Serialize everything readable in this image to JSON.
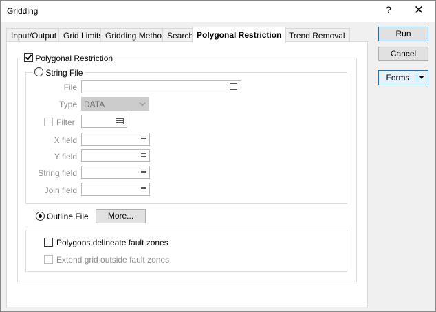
{
  "window": {
    "title": "Gridding",
    "help_label": "?",
    "close_label": "✕"
  },
  "tabs": [
    {
      "label": "Input/Output"
    },
    {
      "label": "Grid Limits"
    },
    {
      "label": "Gridding Method"
    },
    {
      "label": "Search"
    },
    {
      "label": "Polygonal Restriction",
      "active": true
    },
    {
      "label": "Trend Removal"
    }
  ],
  "buttons": {
    "run": "Run",
    "cancel": "Cancel",
    "forms": "Forms"
  },
  "restriction": {
    "checkbox_label": "Polygonal Restriction",
    "checked": true,
    "string_file": {
      "radio_label": "String File",
      "selected": false,
      "file_label": "File",
      "file_value": "",
      "type_label": "Type",
      "type_value": "DATA",
      "filter_label": "Filter",
      "filter_checked": false,
      "x_field_label": "X field",
      "y_field_label": "Y field",
      "string_field_label": "String field",
      "join_field_label": "Join field"
    },
    "outline_file": {
      "radio_label": "Outline File",
      "selected": true,
      "more_label": "More..."
    },
    "fault": {
      "delineate_label": "Polygons delineate fault zones",
      "delineate_checked": false,
      "extend_label": "Extend grid outside fault zones",
      "extend_checked": false
    }
  },
  "icons": {
    "close": "close-icon",
    "browse": "browse-icon",
    "list": "list-icon",
    "filter": "filter-icon",
    "dropdown": "chevron-down-icon"
  }
}
